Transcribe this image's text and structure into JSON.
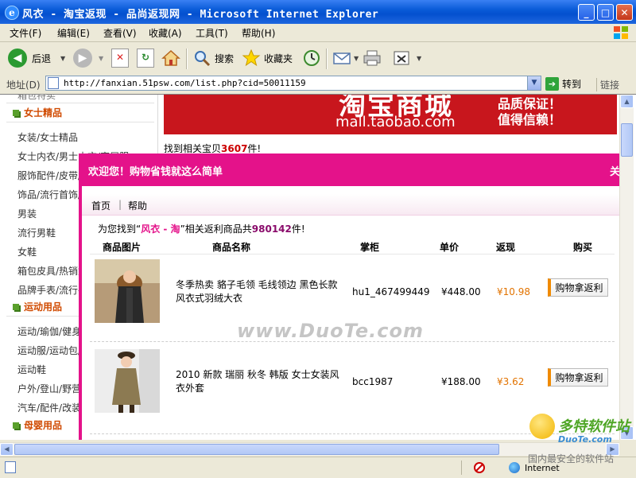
{
  "window": {
    "title": "风衣 - 淘宝返现 - 品尚返现网 - Microsoft Internet Explorer"
  },
  "menu": [
    "文件(F)",
    "编辑(E)",
    "查看(V)",
    "收藏(A)",
    "工具(T)",
    "帮助(H)"
  ],
  "toolbar": {
    "back": "后退",
    "search": "搜索",
    "favorites": "收藏夹"
  },
  "address": {
    "label": "地址(D)",
    "url": "http://fanxian.51psw.com/list.php?cid=50011159",
    "go": "转到",
    "links": "链接"
  },
  "banner": {
    "title": "淘宝商城",
    "url": "mall.taobao.com",
    "promo1": "品质保证！",
    "promo2": "值得信赖！"
  },
  "found": {
    "prefix": "找到相关宝贝",
    "count": "3607",
    "suffix": "件!"
  },
  "sidebar": {
    "top_partial": "箱包特卖",
    "categories": [
      {
        "title": "女士精品",
        "items": [
          "女装/女士精品",
          "女士内衣/男士内衣/家居服",
          "服饰配件/皮带/帽子/围巾",
          "饰品/流行首饰/时尚饰品",
          "男装",
          "流行男鞋",
          "女鞋",
          "箱包皮具/热销女包/男包",
          "品牌手表/流行手表"
        ]
      },
      {
        "title": "运动用品",
        "items": [
          "运动/瑜伽/健身/球迷用品",
          "运动服/运动包/颈环配件",
          "运动鞋",
          "户外/登山/野营/旅行用品",
          "汽车/配件/改装/摩托"
        ]
      },
      {
        "title": "母婴用品",
        "items": []
      }
    ]
  },
  "popup": {
    "title": "欢迎您！购物省钱就这么简单",
    "close": "关",
    "nav": [
      "首页",
      "|",
      "帮助"
    ],
    "summary": {
      "p1": "为您找到“",
      "kw": "风衣 - 淘",
      "p2": "”相关返利商品共",
      "count": "980142",
      "p3": "件!"
    },
    "headers": [
      "商品图片",
      "商品名称",
      "掌柜",
      "单价",
      "返现",
      "购买"
    ],
    "products": [
      {
        "name": "冬季热卖 貉子毛领 毛线领边 黑色长款风衣式羽绒大衣",
        "seller": "hu1_467499449",
        "price": "¥448.00",
        "rebate": "¥10.98",
        "buy": "购物拿返利"
      },
      {
        "name": "2010 新款 瑞丽 秋冬 韩版 女士女装风衣外套",
        "seller": "bcc1987",
        "price": "¥188.00",
        "rebate": "¥3.62",
        "buy": "购物拿返利"
      }
    ]
  },
  "status": {
    "zone": "Internet"
  },
  "watermarks": {
    "center": "www.DuoTe.com",
    "logo1": "多特软件站",
    "logo2": "DuoTe.com",
    "logo3": "国内最安全的软件站"
  },
  "colors": {
    "accent": "#E4128A",
    "banner": "#C8161D",
    "category": "#D04A00",
    "rebate": "#E27300"
  }
}
